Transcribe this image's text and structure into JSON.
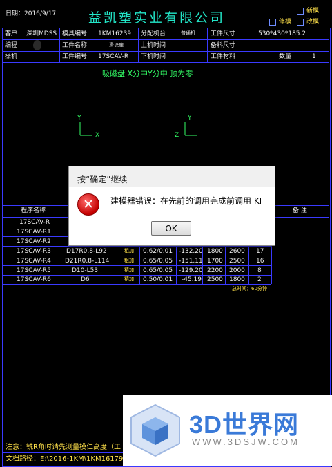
{
  "header": {
    "date": "日期：2016/9/17",
    "company": "益凯塑实业有限公司",
    "opt_new": "新模",
    "opt_repair": "修模",
    "opt_save": "改模"
  },
  "info_rows": [
    [
      "客户",
      "深圳MDSS",
      "模具编号",
      "1KM16239",
      "分配机台",
      "普通机",
      "工件尺寸",
      "530*430*185.2"
    ],
    [
      "编程",
      "",
      "工件名称",
      "滑块座",
      "上机时间",
      "",
      "备料尺寸",
      ""
    ],
    [
      "操机",
      "",
      "工件编号",
      "17SCAV-R",
      "下机时间",
      "",
      "工件材料",
      "",
      "数量",
      "1"
    ]
  ],
  "view_note": "吸磁盘        X分中Y分中  顶为零",
  "axes": [
    {
      "a": "Y",
      "b": "X"
    },
    {
      "a": "Y",
      "b": "Z"
    }
  ],
  "table": {
    "header_left": "程序名称",
    "header_right": "备 注",
    "rows": [
      {
        "name": "17SCAV-R",
        "tool": "",
        "type": "",
        "allow": "",
        "depth": "",
        "speed": "",
        "feed": "",
        "time": ""
      },
      {
        "name": "17SCAV-R1",
        "tool": "",
        "type": "",
        "allow": "",
        "depth": "",
        "speed": "",
        "feed": "",
        "time": ""
      },
      {
        "name": "17SCAV-R2",
        "tool": "",
        "type": "",
        "allow": "",
        "depth": "",
        "speed": "",
        "feed": "",
        "time": ""
      },
      {
        "name": "17SCAV-R3",
        "tool": "D17R0.8-L92",
        "type": "粗加",
        "allow": "0.62/0.01",
        "depth": "-132.20",
        "speed": "1800",
        "feed": "2600",
        "time": "17"
      },
      {
        "name": "17SCAV-R4",
        "tool": "D21R0.8-L114",
        "type": "粗加",
        "allow": "0.65/0.05",
        "depth": "-151.11",
        "speed": "1700",
        "feed": "2500",
        "time": "16"
      },
      {
        "name": "17SCAV-R5",
        "tool": "D10-L53",
        "type": "精加",
        "allow": "0.65/0.05",
        "depth": "-129.20",
        "speed": "2200",
        "feed": "2000",
        "time": "8"
      },
      {
        "name": "17SCAV-R6",
        "tool": "D6",
        "type": "精加",
        "allow": "0.50/0.01",
        "depth": "-45.19",
        "speed": "2500",
        "feed": "1800",
        "time": "2"
      }
    ],
    "total": "总时间：60分钟"
  },
  "footer": {
    "note": "注意：铣R角时请先测量模仁高度（工",
    "path": "文档路径：E:\\2016-1KM\\1KM16179"
  },
  "dialog": {
    "title": "按“确定”继续",
    "message": "建模器错误：在先前的调用完成前调用 KI",
    "ok_label": "OK",
    "icon": "error-x-icon"
  },
  "watermark": {
    "text": "3D世界网",
    "url": "WWW.3DSJW.COM"
  },
  "colors": {
    "background": "#000000",
    "grid": "#3a3aff",
    "axis": "#33ff66",
    "title": "#22e6c8"
  }
}
